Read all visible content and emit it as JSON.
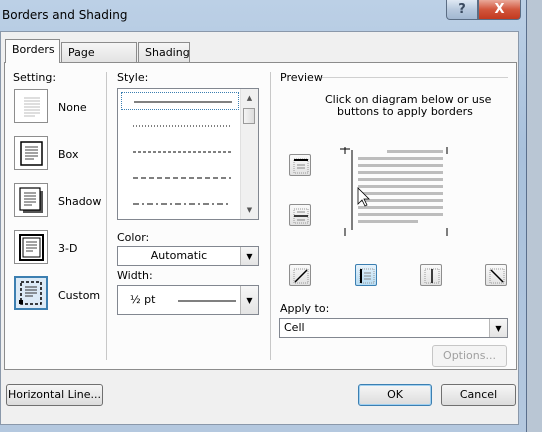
{
  "window": {
    "title": "Borders and Shading",
    "help_glyph": "?",
    "close_glyph": "X"
  },
  "tabs": [
    {
      "label": "Borders",
      "active": true
    },
    {
      "label": "Page Border",
      "active": false
    },
    {
      "label": "Shading",
      "active": false
    }
  ],
  "setting": {
    "heading": "Setting:",
    "items": [
      {
        "label": "None",
        "icon": "setting-none-icon"
      },
      {
        "label": "Box",
        "icon": "setting-box-icon"
      },
      {
        "label": "Shadow",
        "icon": "setting-shadow-icon"
      },
      {
        "label": "3-D",
        "icon": "setting-3d-icon"
      },
      {
        "label": "Custom",
        "icon": "setting-custom-icon",
        "selected": true
      }
    ]
  },
  "style": {
    "heading": "Style:",
    "options": [
      "solid",
      "dotted",
      "dashed-short",
      "dashed",
      "dash-dot"
    ],
    "selected": "solid"
  },
  "color": {
    "heading": "Color:",
    "value": "Automatic"
  },
  "width": {
    "heading": "Width:",
    "value": "½ pt"
  },
  "preview": {
    "heading": "Preview",
    "instructions_line1": "Click on diagram below or use",
    "instructions_line2": "buttons to apply borders",
    "buttons": [
      "top-border-icon",
      "middle-border-icon",
      "diagonal-down-icon",
      "left-border-icon",
      "center-vertical-border-icon",
      "right-border-icon",
      "diagonal-up-icon"
    ]
  },
  "apply_to": {
    "heading": "Apply to:",
    "value": "Cell"
  },
  "buttons": {
    "options": "Options...",
    "horizontal_line": "Horizontal Line...",
    "ok": "OK",
    "cancel": "Cancel"
  },
  "colors": {
    "accent": "#3c7fb1",
    "close": "#c2391f"
  }
}
